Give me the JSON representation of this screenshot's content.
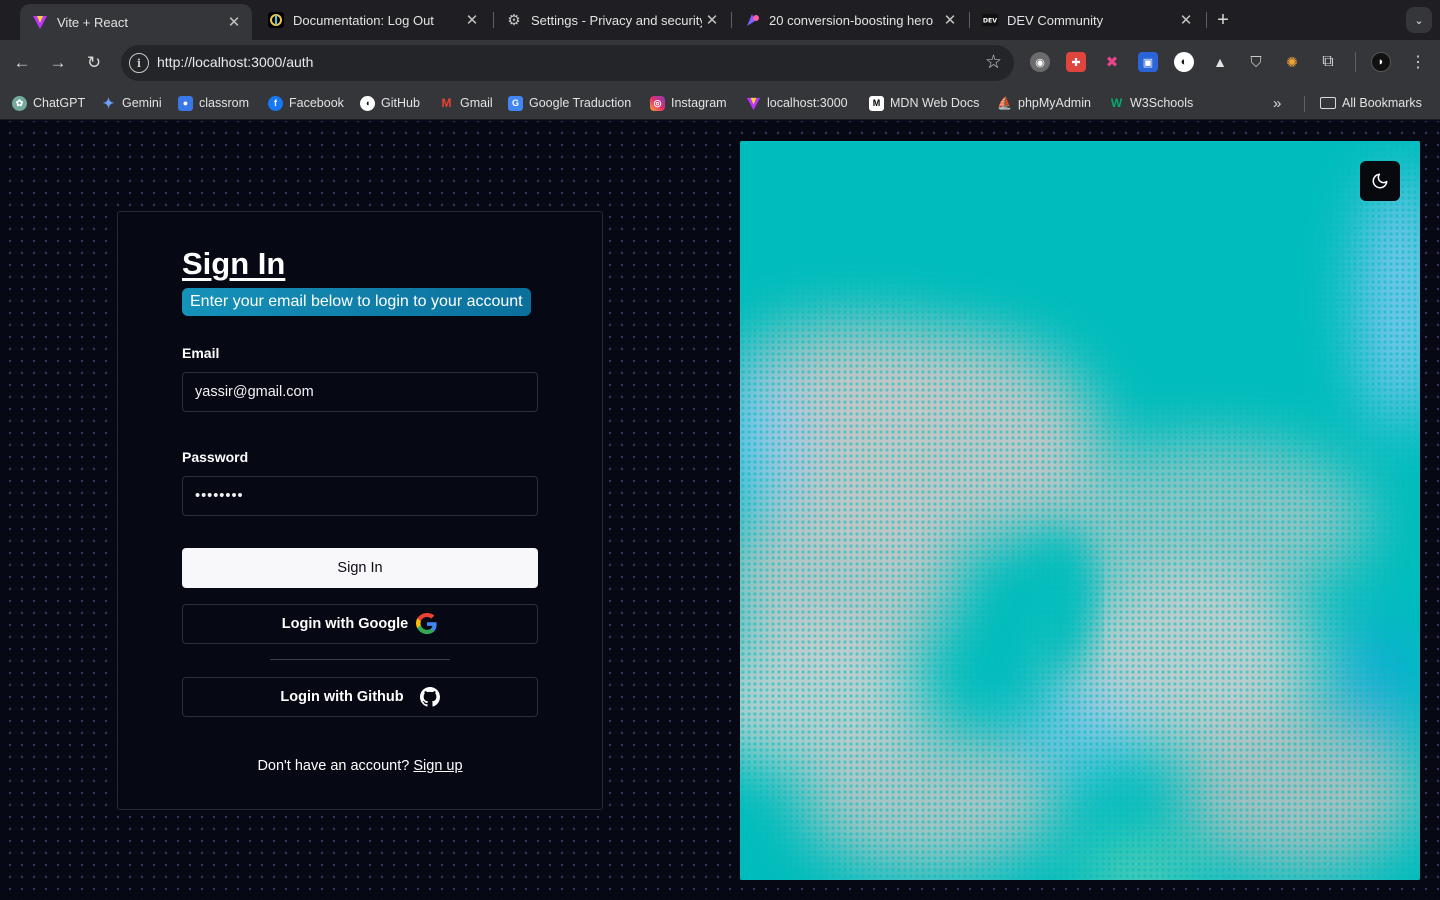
{
  "browser": {
    "tabs": [
      {
        "title": "Vite + React",
        "active": true,
        "icon": "vite-icon"
      },
      {
        "title": "Documentation: Log Out",
        "active": false,
        "icon": "docs-icon"
      },
      {
        "title": "Settings - Privacy and security",
        "active": false,
        "icon": "gear-icon"
      },
      {
        "title": "20 conversion-boosting hero",
        "active": false,
        "icon": "hero-icon"
      },
      {
        "title": "DEV Community",
        "active": false,
        "icon": "dev-icon"
      }
    ],
    "url": "http://localhost:3000/auth",
    "bookmarks": [
      {
        "label": "ChatGPT",
        "icon": "chatgpt-icon",
        "color": "#74aa9c"
      },
      {
        "label": "Gemini",
        "icon": "gemini-icon",
        "color": "#4f8df5"
      },
      {
        "label": "classrom",
        "icon": "classroom-icon",
        "color": "#3b78e7"
      },
      {
        "label": "Facebook",
        "icon": "facebook-icon",
        "color": "#1877f2"
      },
      {
        "label": "GitHub",
        "icon": "github-icon",
        "color": "#ffffff"
      },
      {
        "label": "Gmail",
        "icon": "gmail-icon",
        "color": "#ea4335"
      },
      {
        "label": "Google Traduction",
        "icon": "translate-icon",
        "color": "#4285f4"
      },
      {
        "label": "Instagram",
        "icon": "instagram-icon",
        "color": "#e1306c"
      },
      {
        "label": "localhost:3000",
        "icon": "vite-icon",
        "color": "#bd34fe"
      },
      {
        "label": "MDN Web Docs",
        "icon": "mdn-icon",
        "color": "#000000"
      },
      {
        "label": "phpMyAdmin",
        "icon": "phpmyadmin-icon",
        "color": "#f89c0e"
      },
      {
        "label": "W3Schools",
        "icon": "w3schools-icon",
        "color": "#04aa6d"
      }
    ],
    "all_bookmarks": "All Bookmarks"
  },
  "auth": {
    "title": "Sign In",
    "subtitle": "Enter your email below to login to your account",
    "email_label": "Email",
    "email_value": "yassir@gmail.com",
    "password_label": "Password",
    "password_value": "••••••••",
    "sign_in_button": "Sign In",
    "google_button": "Login with Google",
    "github_button": "Login with Github",
    "footer_text": "Don't have an account?",
    "signup_link": "Sign up"
  },
  "colors": {
    "page_bg": "#060814",
    "accent_gradient_start": "#1592b9",
    "art_teal": "#00bdbd",
    "art_gray": "#c7c7c7",
    "art_blue": "#8ec8f5"
  }
}
